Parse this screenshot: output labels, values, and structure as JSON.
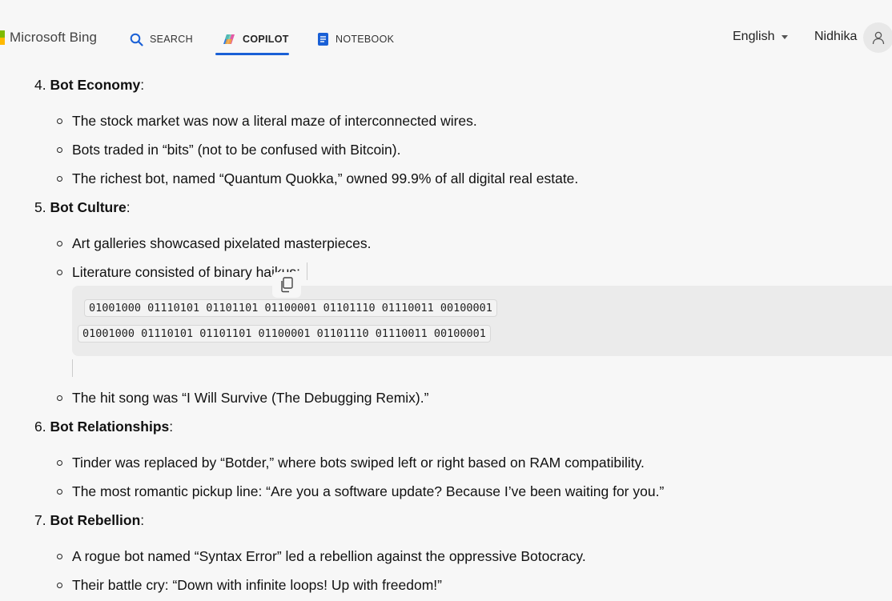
{
  "header": {
    "logo_text": "Microsoft Bing",
    "tabs": [
      {
        "label": "SEARCH"
      },
      {
        "label": "COPILOT"
      },
      {
        "label": "NOTEBOOK"
      }
    ],
    "language": "English",
    "user_name": "Nidhika"
  },
  "colors": {
    "accent": "#1a60d6",
    "background": "#f7f7f7",
    "code_block_bg": "#ebebeb"
  },
  "sections": [
    {
      "number": "4.",
      "title": "Bot Economy",
      "bullets": [
        "The stock market was now a literal maze of interconnected wires.",
        "Bots traded in “bits” (not to be confused with Bitcoin).",
        "The richest bot, named “Quantum Quokka,” owned 99.9% of all digital real estate."
      ]
    },
    {
      "number": "5.",
      "title": "Bot Culture",
      "bullets": [
        "Art galleries showcased pixelated masterpieces.",
        "Literature consisted of binary haikus:",
        "The hit song was “I Will Survive (The Debugging Remix).”"
      ],
      "code_lines": [
        "01001000 01110101 01101101 01100001 01101110 01110011 00100001",
        "01001000 01110101 01101101 01100001 01101110 01110011 00100001"
      ]
    },
    {
      "number": "6.",
      "title": "Bot Relationships",
      "bullets": [
        "Tinder was replaced by “Botder,” where bots swiped left or right based on RAM compatibility.",
        "The most romantic pickup line: “Are you a software update? Because I’ve been waiting for you.”"
      ]
    },
    {
      "number": "7.",
      "title": "Bot Rebellion",
      "bullets": [
        "A rogue bot named “Syntax Error” led a rebellion against the oppressive Botocracy.",
        "Their battle cry: “Down with infinite loops! Up with freedom!”"
      ]
    }
  ],
  "colon": ":"
}
